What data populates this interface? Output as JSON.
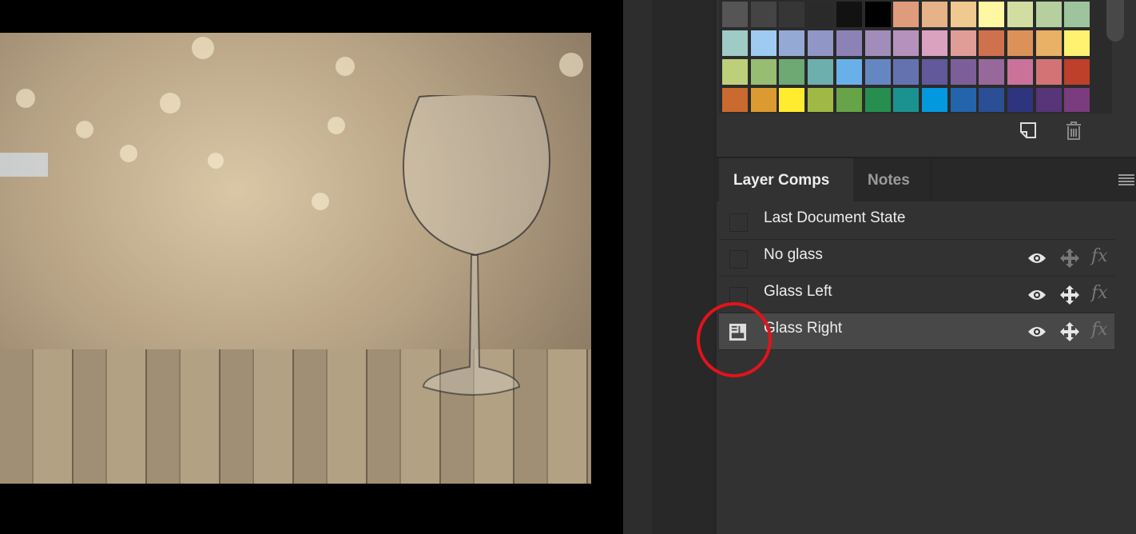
{
  "swatches": [
    [
      "#555555",
      "#444444",
      "#363636",
      "#2a2a2a",
      "#121212",
      "#000000",
      "#de9c7c",
      "#e6b287",
      "#efc98f",
      "#fff7a2",
      "#d2dea1",
      "#b5cf9e",
      "#9dc49c"
    ],
    [
      "#9ecbc6",
      "#9fcbf2",
      "#94a9d4",
      "#9096c6",
      "#8d82b6",
      "#a18cba",
      "#b592bc",
      "#dba2c0",
      "#e09d97",
      "#cf714c",
      "#dc9159",
      "#e8b166",
      "#fff271"
    ],
    [
      "#bdcf7a",
      "#96bd72",
      "#6ea872",
      "#6cafad",
      "#6ab0e8",
      "#6487c2",
      "#6473af",
      "#615999",
      "#7c5f98",
      "#97699a",
      "#cb729b",
      "#d37376",
      "#be3f2a"
    ],
    [
      "#cb6a2f",
      "#db9b30",
      "#ffec2e",
      "#9fb944",
      "#67a347",
      "#268f4f",
      "#1a9390",
      "#0399e0",
      "#2365ad",
      "#2b4f95",
      "#2f347f",
      "#573578",
      "#7a3b7f"
    ]
  ],
  "footer_icons": [
    "new-swatch-icon",
    "trash-icon"
  ],
  "tabs": [
    {
      "label": "Layer Comps"
    },
    {
      "label": "Notes"
    }
  ],
  "layer_comps": [
    {
      "name": "Last Document State",
      "selected": false,
      "icons": false
    },
    {
      "name": "No glass",
      "selected": false,
      "icons": true,
      "position_active": false
    },
    {
      "name": "Glass Left",
      "selected": false,
      "icons": true,
      "position_active": true
    },
    {
      "name": "Glass Right",
      "selected": true,
      "icons": true,
      "position_active": true
    }
  ],
  "highlight_color": "#e3131b"
}
